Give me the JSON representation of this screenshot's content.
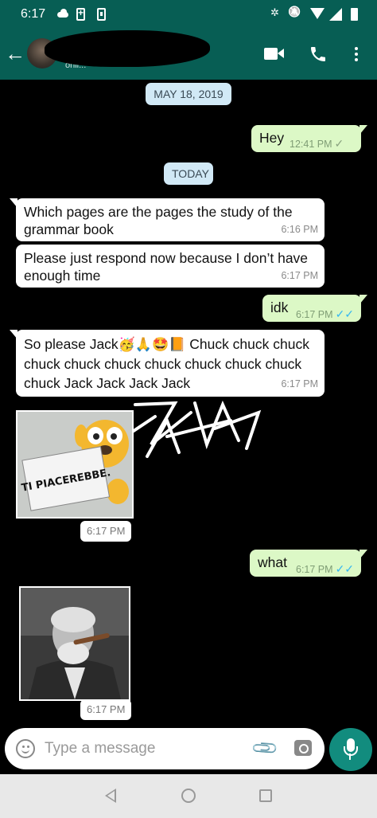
{
  "status_bar": {
    "time": "6:17"
  },
  "header": {
    "contact_status": "onli..."
  },
  "date_chips": {
    "first": "MAY 18, 2019",
    "today": "TODAY"
  },
  "messages": [
    {
      "dir": "out",
      "text": "Hey",
      "time": "12:41 PM",
      "status": "sent"
    },
    {
      "dir": "in",
      "text": "Which pages are the pages the study of the grammar book",
      "time": "6:16 PM"
    },
    {
      "dir": "in",
      "text": "Please just respond now because I don’t have enough time",
      "time": "6:17 PM"
    },
    {
      "dir": "out",
      "text": "idk",
      "time": "6:17 PM",
      "status": "read"
    },
    {
      "dir": "in",
      "text_pre": "So please Jack",
      "emojis": "🥳🙏🤩📙",
      "text_post": " Chuck chuck chuck chuck chuck chuck chuck chuck chuck chuck chuck Jack Jack Jack Jack",
      "time": "6:17 PM"
    },
    {
      "dir": "in",
      "type": "image",
      "image_text": "TI PIACEREBBE.",
      "time": "6:17 PM"
    },
    {
      "dir": "out",
      "text": "what",
      "time": "6:17 PM",
      "status": "read"
    },
    {
      "dir": "in",
      "type": "image",
      "time": "6:17 PM"
    }
  ],
  "composer": {
    "placeholder": "Type a message"
  },
  "colors": {
    "header": "#075e54",
    "outgoing": "#dcf8c6",
    "incoming": "#ffffff",
    "fab": "#128c7e",
    "read_tick": "#34b7f1"
  }
}
